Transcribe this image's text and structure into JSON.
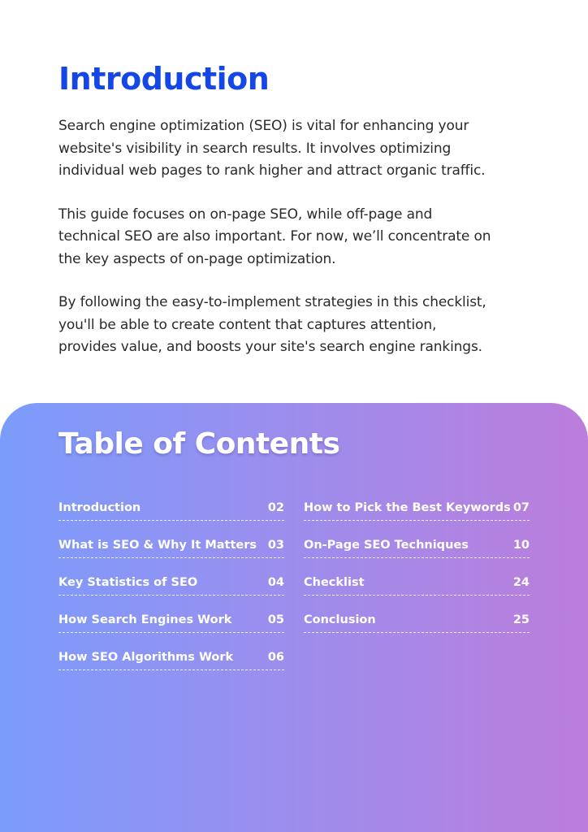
{
  "intro": {
    "title": "Introduction",
    "paragraphs": [
      {
        "lines": [
          "Search engine optimization (SEO) is vital for enhancing your",
          "website's visibility in search results. It involves optimizing",
          "individual web pages to rank higher and attract organic traffic."
        ]
      },
      {
        "lines": [
          "This guide focuses on on-page SEO, while off-page and",
          "technical SEO are also important. For now, we’ll concentrate on",
          "the key aspects of on-page optimization."
        ]
      },
      {
        "lines": [
          "By following the easy-to-implement strategies in this checklist,",
          "you'll be able to create content that captures attention,",
          "provides value, and boosts your site's search engine rankings."
        ]
      }
    ]
  },
  "toc": {
    "title": "Table of Contents",
    "left": [
      {
        "label": "Introduction",
        "page": "02"
      },
      {
        "label": "What is SEO & Why It Matters",
        "page": "03"
      },
      {
        "label": "Key Statistics of SEO",
        "page": "04"
      },
      {
        "label": "How Search Engines Work",
        "page": "05"
      },
      {
        "label": "How SEO Algorithms Work",
        "page": "06"
      }
    ],
    "right": [
      {
        "label": "How to Pick the Best Keywords",
        "page": "07"
      },
      {
        "label": "On-Page SEO Techniques",
        "page": "10"
      },
      {
        "label": "Checklist",
        "page": "24"
      },
      {
        "label": "Conclusion",
        "page": "25"
      }
    ]
  },
  "colors": {
    "title_blue": "#1546e6",
    "gradient_start": "#7b9cfc",
    "gradient_end": "#bc7ddb"
  }
}
